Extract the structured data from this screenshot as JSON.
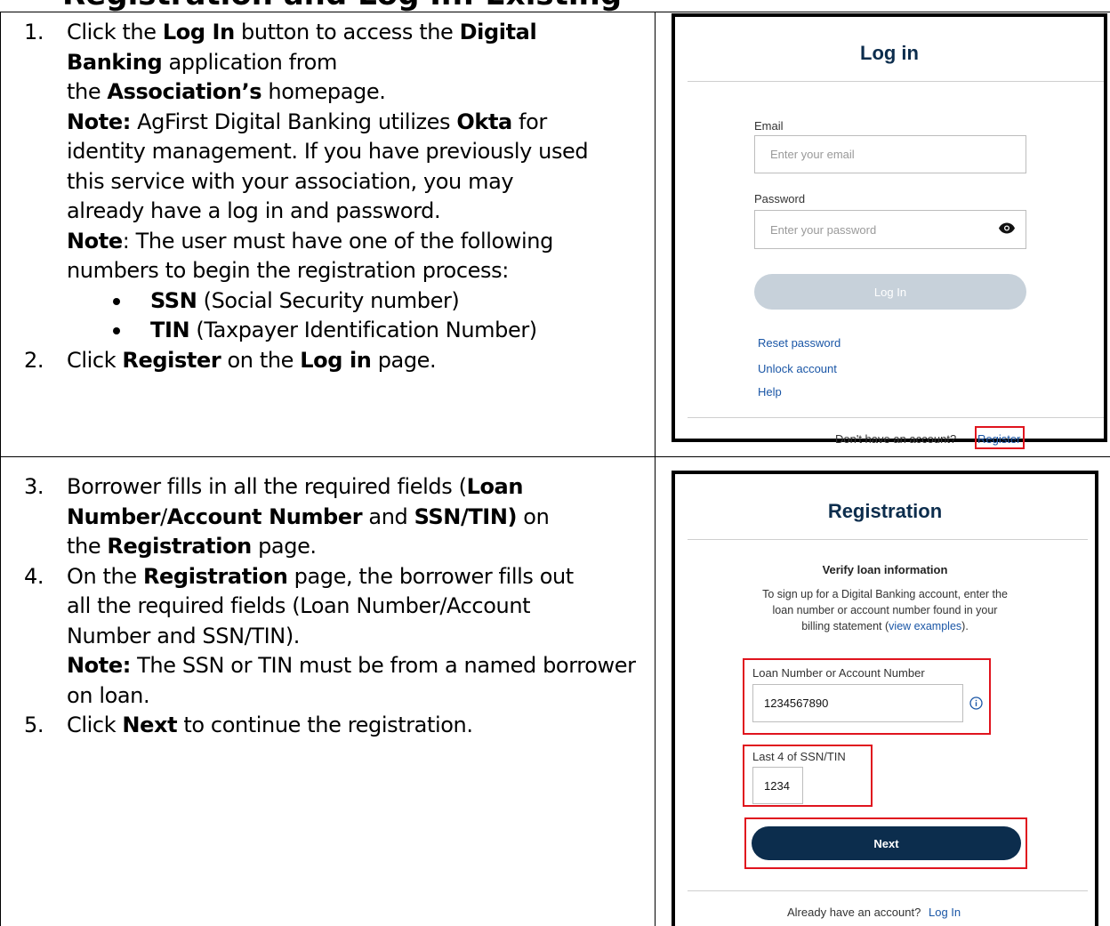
{
  "heading": "Registration and Log In: Existing",
  "steps_top": {
    "s1": {
      "num": "1.",
      "a": "Click the ",
      "b": "Log In",
      "c": " button to access the ",
      "d": "Digital",
      "e": "Banking",
      "f": " application from",
      "g": "the ",
      "h": "Association’s",
      "i": " homepage.",
      "note1_label": "Note:",
      "note1_a": " AgFirst Digital Banking utilizes ",
      "note1_b": "Okta",
      "note1_c": " for",
      "note1_line2": "identity management. If you have previously used",
      "note1_line3": "this service with your association, you may",
      "note1_line4": "already have a log in and password.",
      "note2_label": "Note",
      "note2_a": ": The user must have one of the following",
      "note2_line2": "numbers to begin the registration process:",
      "bullets": [
        {
          "bold": "SSN",
          "text": " (Social Security number)"
        },
        {
          "bold": "TIN",
          "text": " (Taxpayer Identification Number)"
        }
      ]
    },
    "s2": {
      "num": "2.",
      "a": "Click ",
      "b": "Register",
      "c": " on the ",
      "d": "Log in",
      "e": " page."
    }
  },
  "steps_bottom": {
    "s3": {
      "num": "3.",
      "a": "Borrower fills in all the required fields (",
      "b": "Loan",
      "c": "Number",
      "d": "/",
      "e": "Account Number",
      "f": " and ",
      "g": "SSN/TIN)",
      "h": " on",
      "i": "the ",
      "j": "Registration",
      "k": " page."
    },
    "s4": {
      "num": "4.",
      "a": "On the ",
      "b": "Registration",
      "c": " page, the borrower fills out",
      "line2": "all the required fields (Loan Number/Account",
      "line3": "Number and SSN/TIN).",
      "note_label": "Note:",
      "note_a": " The SSN or TIN must be from a named borrower",
      "note_line2": "on loan."
    },
    "s5": {
      "num": "5.",
      "a": "Click ",
      "b": "Next",
      "c": " to continue the registration."
    }
  },
  "login_panel": {
    "title": "Log in",
    "email_label": "Email",
    "email_placeholder": "Enter your email",
    "password_label": "Password",
    "password_placeholder": "Enter your password",
    "login_button": "Log In",
    "links": [
      "Reset password",
      "Unlock account",
      "Help"
    ],
    "footer_text": "Don't have an account?",
    "footer_link": "Register"
  },
  "registration_panel": {
    "title": "Registration",
    "subtitle": "Verify loan information",
    "description_lines": [
      "To sign up for a Digital Banking account, enter the",
      "loan number or account number found in your"
    ],
    "description_line3_a": "billing statement (",
    "description_link": "view examples",
    "description_line3_b": ").",
    "loan_label": "Loan Number or Account Number",
    "loan_value": "1234567890",
    "ssn_label": "Last 4 of SSN/TIN",
    "ssn_value": "1234",
    "next_button": "Next",
    "footer_text": "Already have an account?",
    "footer_link": "Log In"
  },
  "colors": {
    "navy": "#0c2d4d",
    "link": "#1a56a6",
    "highlight": "#e0141e",
    "disabled_button": "#c7d1da"
  },
  "icons": [
    "eye-icon",
    "info-icon",
    "bullet-icon"
  ]
}
